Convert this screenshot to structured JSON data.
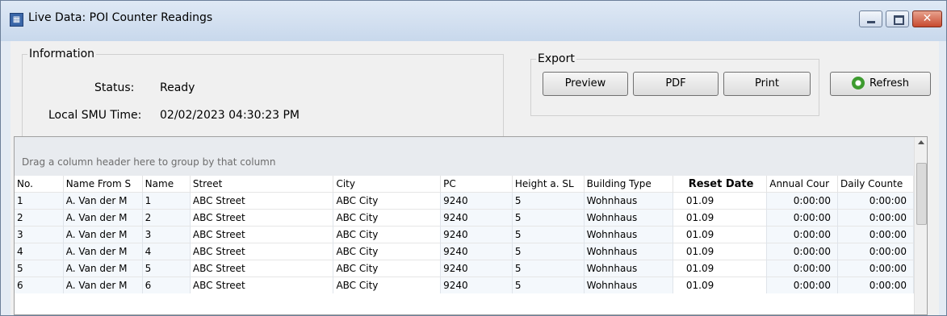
{
  "window": {
    "title": "Live Data: POI Counter Readings",
    "controls": {
      "close_glyph": "✕"
    }
  },
  "info": {
    "legend": "Information",
    "status_label": "Status:",
    "status_value": "Ready",
    "time_label": "Local SMU Time:",
    "time_value": "02/02/2023 04:30:23 PM"
  },
  "export": {
    "legend": "Export",
    "preview_label": "Preview",
    "pdf_label": "PDF",
    "print_label": "Print"
  },
  "refresh_label": "Refresh",
  "grid": {
    "group_hint": "Drag a column header here to group by that column",
    "columns": [
      "No.",
      "Name From S",
      "Name",
      "Street",
      "City",
      "PC",
      "Height a. SL",
      "Building Type",
      "Reset Date",
      "Annual Cour",
      "Daily Counte"
    ],
    "rows": [
      [
        "1",
        "A. Van der M",
        "1",
        "ABC Street",
        "ABC City",
        "9240",
        "5",
        "Wohnhaus",
        "01.09",
        "0:00:00",
        "0:00:00"
      ],
      [
        "2",
        "A. Van der M",
        "2",
        "ABC Street",
        "ABC City",
        "9240",
        "5",
        "Wohnhaus",
        "01.09",
        "0:00:00",
        "0:00:00"
      ],
      [
        "3",
        "A. Van der M",
        "3",
        "ABC Street",
        "ABC City",
        "9240",
        "5",
        "Wohnhaus",
        "01.09",
        "0:00:00",
        "0:00:00"
      ],
      [
        "4",
        "A. Van der M",
        "4",
        "ABC Street",
        "ABC City",
        "9240",
        "5",
        "Wohnhaus",
        "01.09",
        "0:00:00",
        "0:00:00"
      ],
      [
        "5",
        "A. Van der M",
        "5",
        "ABC Street",
        "ABC City",
        "9240",
        "5",
        "Wohnhaus",
        "01.09",
        "0:00:00",
        "0:00:00"
      ],
      [
        "6",
        "A. Van der M",
        "6",
        "ABC Street",
        "ABC City",
        "9240",
        "5",
        "Wohnhaus",
        "01.09",
        "0:00:00",
        "0:00:00"
      ]
    ]
  }
}
